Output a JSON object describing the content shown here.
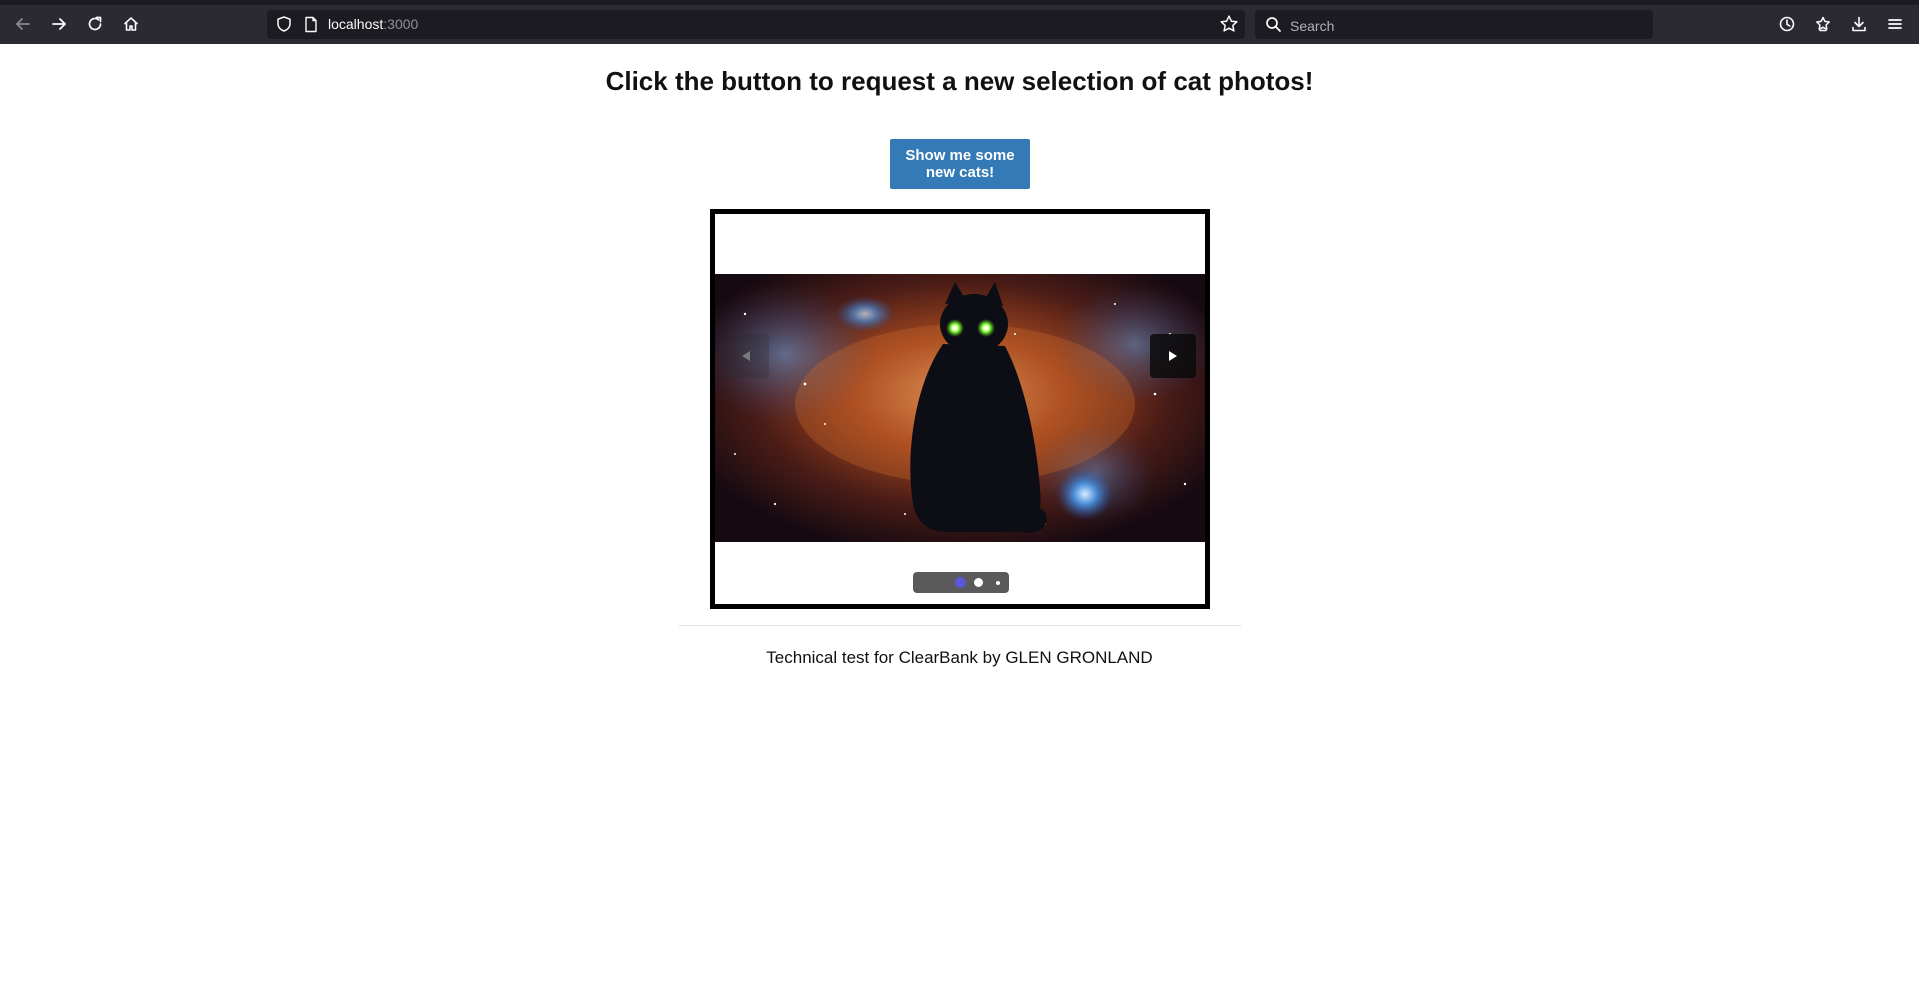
{
  "browser": {
    "url_host": "localhost",
    "url_port": ":3000",
    "search_placeholder": "Search"
  },
  "page": {
    "headline": "Click the button to request a new selection of cat photos!",
    "button_label": "Show me some new cats!",
    "footer": "Technical test for ClearBank by GLEN GRONLAND"
  },
  "carousel": {
    "slide_count": 3,
    "active_slide": 1,
    "slide_description": "black cat with glowing green eyes on a nebula background",
    "prev_icon": "triangle-left-icon",
    "next_icon": "triangle-right-icon"
  },
  "colors": {
    "button_bg": "#337ab7",
    "toolbar_bg": "#2b2a33",
    "urlbar_bg": "#1c1b22",
    "active_dot": "#5b57d9"
  }
}
